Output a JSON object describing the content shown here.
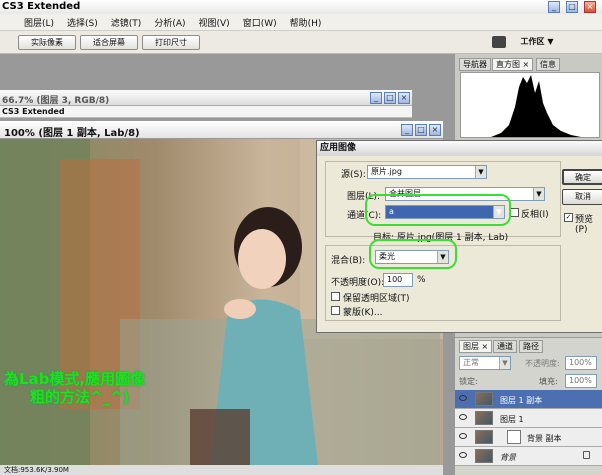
{
  "app": {
    "title": "CS3 Extended"
  },
  "menu": [
    "图层(L)",
    "选择(S)",
    "滤镜(T)",
    "分析(A)",
    "视图(V)",
    "窗口(W)",
    "帮助(H)"
  ],
  "options": {
    "btn1": "实际像素",
    "btn2": "适合屏幕",
    "btn3": "打印尺寸",
    "workspace": "工作区 ▼"
  },
  "docs": {
    "back_title": "66.7% (图层 3, RGB/8)",
    "back_sub": "CS3 Extended",
    "front_title": "100% (图层 1 副本, Lab/8)"
  },
  "status": {
    "text": "文档:953.6K/3.90M"
  },
  "panel_tabs": [
    "导航器",
    "直方图 ×",
    "信息"
  ],
  "dialog": {
    "title": "应用图像",
    "source_label": "源(S):",
    "source_value": "原片.jpg",
    "layer_label": "图层(L):",
    "layer_value": "合并图层",
    "channel_label": "通道(C):",
    "channel_value": "a",
    "invert_label": "反相(I)",
    "target_text": "目标: 原片.jpg(图层 1 副本, Lab)",
    "blend_label": "混合(B):",
    "blend_value": "柔光",
    "opacity_label": "不透明度(O):",
    "opacity_value": "100",
    "opacity_unit": "%",
    "preserve_label": "保留透明区域(T)",
    "mask_label": "蒙版(K)...",
    "ok": "确定",
    "cancel": "取消",
    "preview": "预览(P)"
  },
  "layers_panel": {
    "tabs": [
      "图层 ×",
      "通道",
      "路径"
    ],
    "mode": "正常",
    "opacity_label": "不透明度:",
    "opacity_value": "100%",
    "lock_label": "锁定:",
    "fill_label": "填充:",
    "fill_value": "100%",
    "rows": [
      "图层 1 副本",
      "图层 1",
      "背景 副本",
      "背景"
    ]
  },
  "overlay": {
    "line1": "為Lab模式,應用圖像",
    "line2": "粗的方法^_^)"
  }
}
